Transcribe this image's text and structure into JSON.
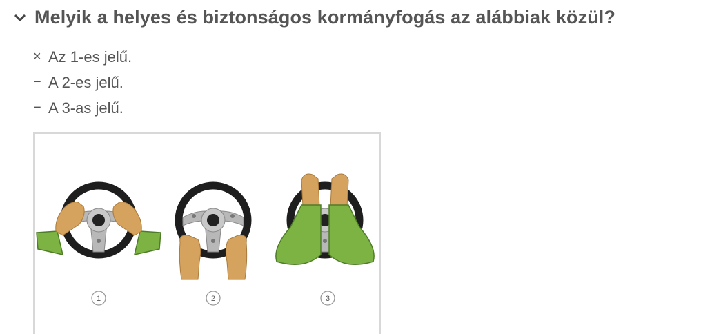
{
  "question": {
    "title": "Melyik a helyes és biztonságos kormányfogás az alábbiak közül?",
    "collapse_icon": "chevron-down-icon"
  },
  "answers": [
    {
      "marker": "×",
      "text": "Az 1-es jelű.",
      "status": "wrong"
    },
    {
      "marker": "−",
      "text": "A 2-es jelű.",
      "status": "neutral"
    },
    {
      "marker": "−",
      "text": "A 3-as jelű.",
      "status": "neutral"
    }
  ],
  "figure": {
    "labels": [
      "1",
      "2",
      "3"
    ],
    "colors": {
      "rim": "#1e1e1e",
      "spoke": "#b8b8b8",
      "skin": "#d6a35e",
      "sleeve": "#7cb342",
      "sleeve_dark": "#4e7d28"
    }
  }
}
